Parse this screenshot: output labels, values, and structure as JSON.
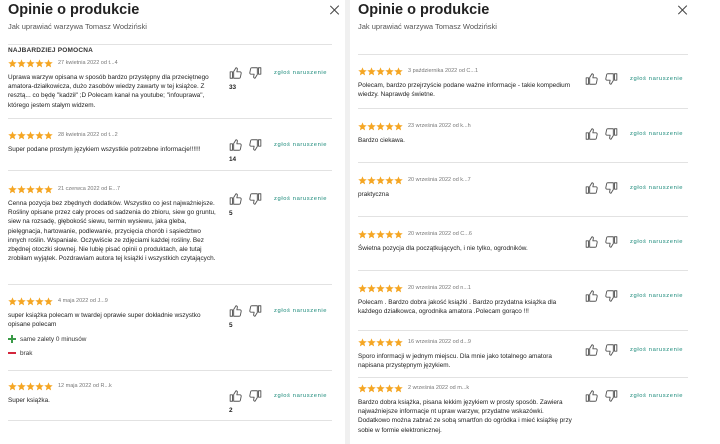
{
  "left": {
    "title": "Opinie o produkcie",
    "subtitle": "Jak uprawiać warzywa Tomasz Wodziński",
    "section_label": "NAJBARDZIEJ POMOCNA",
    "report_label": "zgłoś naruszenie",
    "reviews": [
      {
        "meta": "27 kwietnia 2022 od t...4",
        "text": "Uprawa warzyw opisana w sposób bardzo przystępny dla przeciętnego amatora-działkowicza, dużo zasobów wiedzy zawarty w tej książce. Z resztą... co będę \"kadził\" ;D Polecam kanał na youtube; \"infouprawa\", którego jestem stałym widzem.",
        "likes": "33"
      },
      {
        "meta": "28 kwietnia 2022 od t...2",
        "text": "Super podane prostym językiem wszystkie potrzebne informacje!!!!!!",
        "likes": "14"
      },
      {
        "meta": "21 czerwca 2022 od E...7",
        "text": "Cenna pozycja bez zbędnych dodatków. Wszystko co jest najważniejsze. Rośliny opisane przez cały proces od sadzenia do zbioru, siew go gruntu, siew na rozsadę, głębokość siewu, termin wysiewu, jaka gleba, pielęgnacja, hartowanie, podlewanie, przycięcia chorób i sąsiedztwo innych roślin. Wspaniale. Oczywiście ze zdjęciami każdej rośliny. Bez zbędnej otoczki słownej. Nie lubię pisać opinii o produktach, ale tutaj zrobiłam wyjątek. Pozdrawiam autora tej książki i wszystkich czytających.",
        "likes": "5"
      },
      {
        "meta": "4 maja 2022 od J...9",
        "text": "super książka polecam w twardej oprawie super dokładnie wszystko opisane polecam",
        "likes": "5",
        "pros": "same zalety 0 minusów",
        "cons": "brak"
      },
      {
        "meta": "12 maja 2022 od R...k",
        "text": "Super książka.",
        "likes": "2"
      }
    ]
  },
  "right": {
    "title": "Opinie o produkcie",
    "subtitle": "Jak uprawiać warzywa Tomasz Wodziński",
    "report_label": "zgłoś naruszenie",
    "reviews": [
      {
        "meta": "3 października 2022 od C...1",
        "text": "Polecam, bardzo przejrzyście podane ważne informacje - takie kompedium wiedzy. Naprawdę świetne."
      },
      {
        "meta": "23 września 2022 od k...h",
        "text": "Bardzo ciekawa."
      },
      {
        "meta": "20 września 2022 od k...7",
        "text": "praktyczna"
      },
      {
        "meta": "20 września 2022 od C...6",
        "text": "Świetna pozycja dla początkujących, i nie tylko, ogrodników."
      },
      {
        "meta": "20 września 2022 od n...1",
        "text": "Polecam . Bardzo dobra jakość książki . Bardzo przydatna książka dla każdego działkowca, ogrodnika amatora .Polecam gorąco !!!"
      },
      {
        "meta": "16 września 2022 od d...9",
        "text": "Sporo informacji w jednym miejscu. Dla mnie jako totalnego amatora napisana przystępnym językiem."
      },
      {
        "meta": "2 września 2022 od m...k",
        "text": "Bardzo dobra książka, pisana lekkim językiem w prosty sposób. Zawiera najważniejsze informacje nt upraw warzyw, przydatne wskazówki. Dodatkowo można zabrać ze sobą smartfon do ogródka i mieć książkę przy sobie w formie elektronicznej."
      }
    ]
  },
  "colors": {
    "star": "#f5a623",
    "report_link": "#1b8a7a",
    "plus": "#3a9a47",
    "minus": "#d3263c"
  },
  "icons": {
    "close": "close-icon",
    "star": "star-icon",
    "like": "thumb-up-icon",
    "dislike": "thumb-down-icon",
    "plus": "plus-icon",
    "minus": "minus-icon"
  }
}
